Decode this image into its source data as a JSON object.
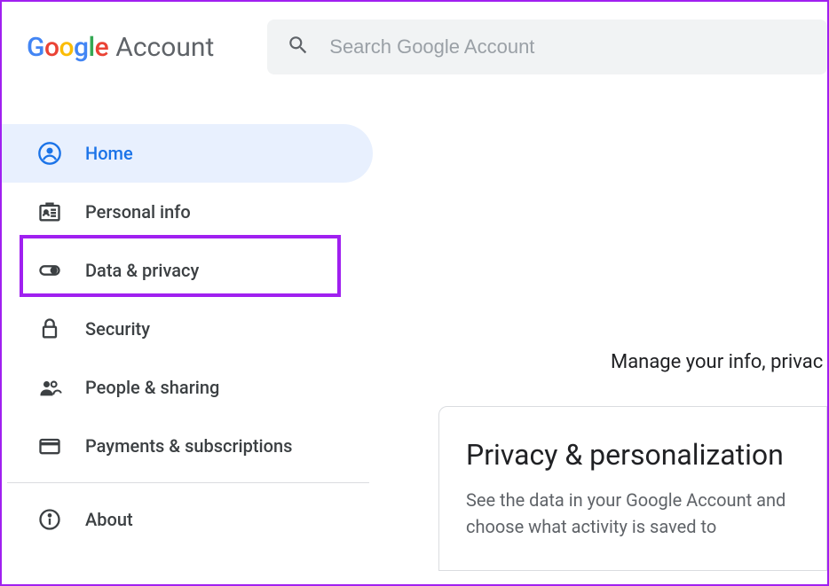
{
  "header": {
    "logo_suffix": "Account",
    "search_placeholder": "Search Google Account"
  },
  "sidebar": {
    "items": [
      {
        "label": "Home"
      },
      {
        "label": "Personal info"
      },
      {
        "label": "Data & privacy"
      },
      {
        "label": "Security"
      },
      {
        "label": "People & sharing"
      },
      {
        "label": "Payments & subscriptions"
      },
      {
        "label": "About"
      }
    ]
  },
  "main": {
    "subtitle": "Manage your info, privac",
    "card": {
      "title": "Privacy & personalization",
      "description": "See the data in your Google Account and choose what activity is saved to"
    }
  }
}
